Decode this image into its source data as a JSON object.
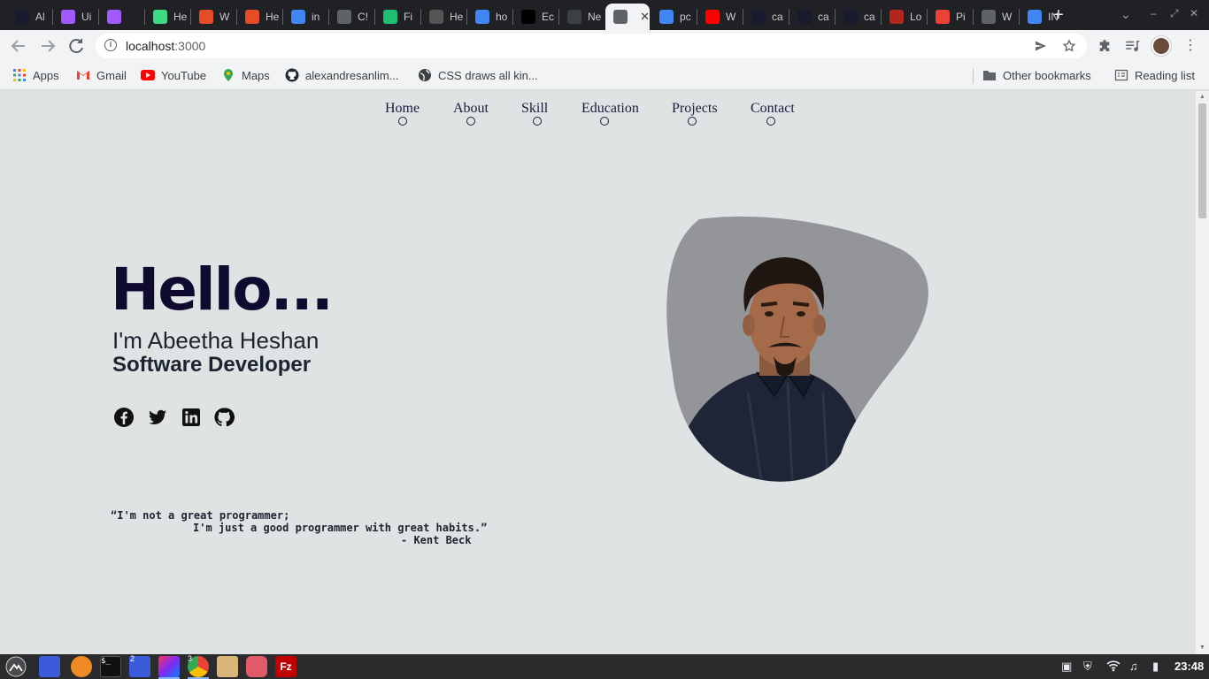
{
  "browser": {
    "tabs": [
      {
        "title": "Al",
        "icon": "intellij-icon",
        "color": "#1a1a2e"
      },
      {
        "title": "Ui",
        "icon": "figma-icon",
        "color": "#a259ff"
      },
      {
        "title": "",
        "icon": "figma-icon",
        "color": "#a259ff"
      },
      {
        "title": "He",
        "icon": "android-icon",
        "color": "#3ddc84"
      },
      {
        "title": "W",
        "icon": "html-icon",
        "color": "#e44d26"
      },
      {
        "title": "He",
        "icon": "html-icon",
        "color": "#e44d26"
      },
      {
        "title": "in",
        "icon": "google-icon",
        "color": "#4285f4"
      },
      {
        "title": "C!",
        "icon": "globe-icon",
        "color": "#5f6368"
      },
      {
        "title": "Fi",
        "icon": "fiverr-icon",
        "color": "#1dbf73"
      },
      {
        "title": "He",
        "icon": "html5-icon",
        "color": "#555555"
      },
      {
        "title": "ho",
        "icon": "google-icon",
        "color": "#4285f4"
      },
      {
        "title": "Ec",
        "icon": "unsplash-icon",
        "color": "#000000"
      },
      {
        "title": "Ne",
        "icon": "globe-icon",
        "color": "#3c4043"
      },
      {
        "title": "",
        "icon": "globe-icon",
        "color": "#5f6368",
        "active": true
      },
      {
        "title": "pc",
        "icon": "google-icon",
        "color": "#4285f4"
      },
      {
        "title": "W",
        "icon": "youtube-icon",
        "color": "#ff0000"
      },
      {
        "title": "ca",
        "icon": "intellij-icon",
        "color": "#1a1a2e"
      },
      {
        "title": "ca",
        "icon": "intellij-icon",
        "color": "#1a1a2e"
      },
      {
        "title": "ca",
        "icon": "intellij-icon",
        "color": "#1a1a2e"
      },
      {
        "title": "Lo",
        "icon": "lock-icon",
        "color": "#b3261e"
      },
      {
        "title": "Pi",
        "icon": "gmail-icon",
        "color": "#ea4335"
      },
      {
        "title": "W",
        "icon": "globe-icon",
        "color": "#5f6368"
      },
      {
        "title": "IN",
        "icon": "docs-icon",
        "color": "#4285f4"
      }
    ],
    "new_tab_label": "+",
    "url_host": "localhost",
    "url_port": ":3000",
    "bookmarks": [
      {
        "label": "Apps",
        "icon": "apps-grid-icon"
      },
      {
        "label": "Gmail",
        "icon": "gmail-icon"
      },
      {
        "label": "YouTube",
        "icon": "youtube-icon"
      },
      {
        "label": "Maps",
        "icon": "maps-icon"
      },
      {
        "label": "alexandresanlim...",
        "icon": "github-icon"
      },
      {
        "label": "CSS draws all kin...",
        "icon": "globe-icon"
      }
    ],
    "other_bookmarks": "Other bookmarks",
    "reading_list": "Reading list"
  },
  "site": {
    "nav": [
      "Home",
      "About",
      "Skill",
      "Education",
      "Projects",
      "Contact"
    ],
    "hero": {
      "greeting": "Hello...",
      "intro": "I'm Abeetha Heshan",
      "role": "Software Developer"
    },
    "social": [
      {
        "name": "facebook-icon"
      },
      {
        "name": "twitter-icon"
      },
      {
        "name": "linkedin-icon"
      },
      {
        "name": "github-icon"
      }
    ],
    "quote": {
      "line1": "“I'm not a great programmer;",
      "line2": "I'm just a good programmer with great habits.”",
      "author": "- Kent Beck"
    }
  },
  "taskbar": {
    "clock": "23:48",
    "chrome_count": "3",
    "files_count": "2"
  }
}
